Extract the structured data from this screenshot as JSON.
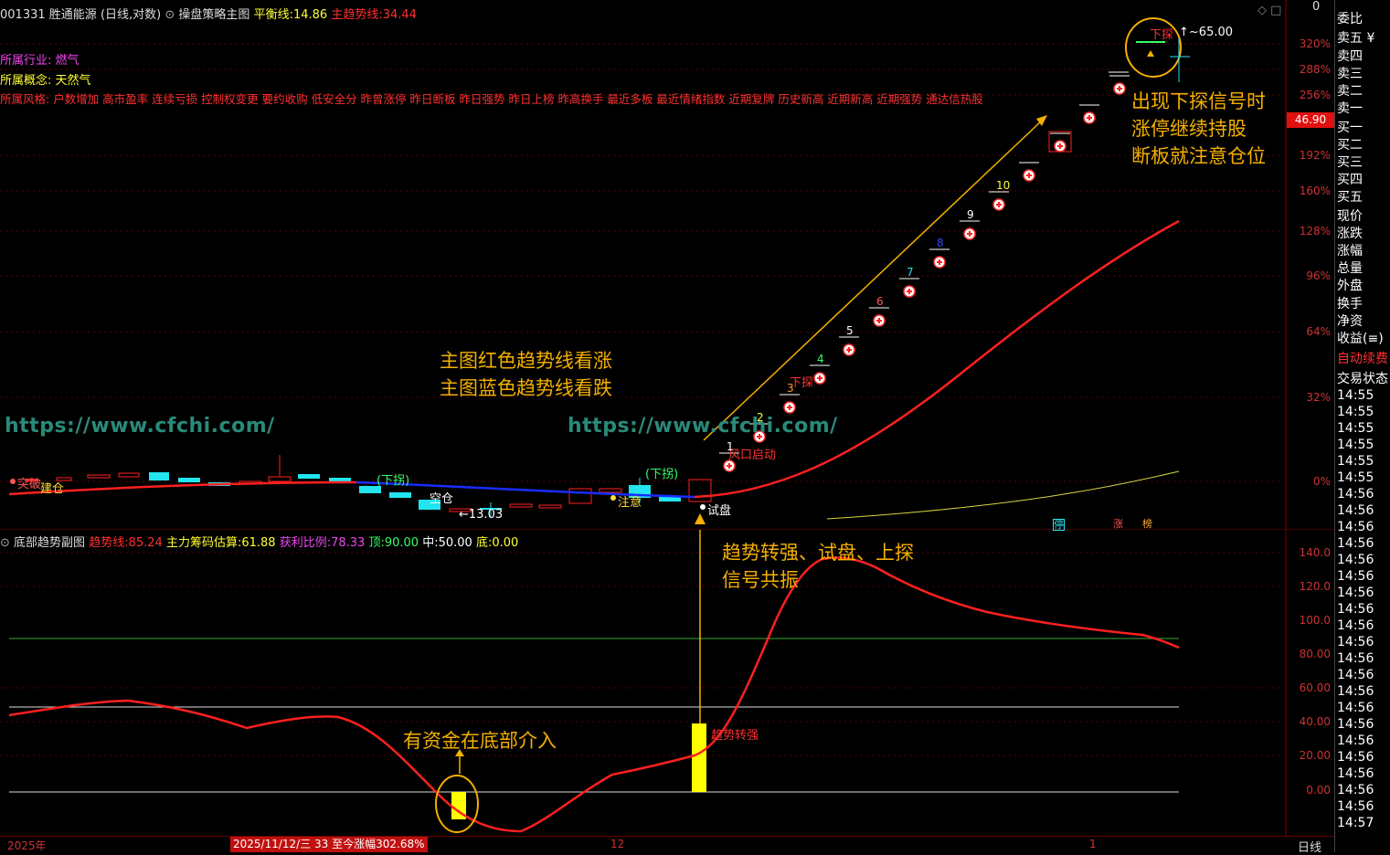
{
  "header": {
    "stock_code": "001331",
    "stock_name": "胜通能源",
    "period": "(日线,对数)",
    "indicator_name": "操盘策略主图",
    "balance_label": "平衡线:",
    "balance_value": "14.86",
    "trend_label": "主趋势线:",
    "trend_value": "34.44"
  },
  "info": {
    "industry_label": "所属行业:",
    "industry_value": "燃气",
    "concept_label": "所属概念:",
    "concept_value": "天然气",
    "style_label": "所属风格:",
    "style_value": "户数增加 高市盈率 连续亏损 控制权变更 要约收购 低安全分 昨曾涨停 昨日断板 昨日强势 昨日上榜 昨高换手 最近多板 最近情绪指数 近期复牌 历史新高 近期新高 近期强势 通达信热股"
  },
  "callouts": {
    "signal_lines": [
      "出现下探信号时",
      "涨停继续持股",
      "断板就注意仓位"
    ],
    "trend_lines": [
      "主图红色趋势线看涨",
      "主图蓝色趋势线看跌"
    ],
    "resonance_lines": [
      "趋势转强、试盘、上探",
      "信号共振"
    ],
    "bottom_fund": "有资金在底部介入"
  },
  "watermark": "https://www.cfchi.com/",
  "main_labels": {
    "breakout": "突破",
    "build": "建仓",
    "xiaguai1": "(下拐)",
    "xiaguai2": "(下拐)",
    "kongcang": "空仓",
    "low_price": "←13.03",
    "attention": "注意",
    "trial": "试盘",
    "wind_start": "风口启动",
    "probe1": "下探",
    "probe2": "下探",
    "high_price": "65.00",
    "stop": "停",
    "zhang": "涨",
    "bang": "榜"
  },
  "counts": [
    "1",
    "2",
    "3",
    "4",
    "5",
    "6",
    "7",
    "8",
    "9",
    "10"
  ],
  "price_axis": {
    "labels": [
      "320%",
      "288%",
      "256%",
      "192%",
      "160%",
      "128%",
      "96%",
      "64%",
      "32%",
      "0%"
    ],
    "current": "46.90"
  },
  "sub_header": {
    "name": "底部趋势副图",
    "trend_label": "趋势线:",
    "trend_value": "85.24",
    "chip_label": "主力筹码估算:",
    "chip_value": "61.88",
    "profit_label": "获利比例:",
    "profit_value": "78.33",
    "top_label": "顶:",
    "top_value": "90.00",
    "mid_label": "中:",
    "mid_value": "50.00",
    "bottom_label": "底:",
    "bottom_value": "0.00",
    "trend_strong": "趋势转强"
  },
  "sub_axis": [
    "140.0",
    "120.0",
    "100.0",
    "80.00",
    "60.00",
    "40.00",
    "20.00",
    "0.00"
  ],
  "bottom_bar": {
    "year": "2025年",
    "range_text": "2025/11/12/三 33 至今涨幅302.68%",
    "month1": "12",
    "month2": "1",
    "period": "日线"
  },
  "right_panel": {
    "items": [
      "委比",
      "卖五 ¥",
      "卖四",
      "卖三",
      "卖二",
      "卖一",
      "买一",
      "买二",
      "买三",
      "买四",
      "买五",
      "现价",
      "涨跌",
      "涨幅",
      "总量",
      "外盘",
      "换手",
      "净资",
      "收益(≡)"
    ],
    "auto_label": "自动续费",
    "trade_state": "交易状态",
    "times": [
      "14:55",
      "14:55",
      "14:55",
      "14:55",
      "14:55",
      "14:55",
      "14:56",
      "14:56",
      "14:56",
      "14:56",
      "14:56",
      "14:56",
      "14:56",
      "14:56",
      "14:56",
      "14:56",
      "14:56",
      "14:56",
      "14:56",
      "14:56",
      "14:56",
      "14:56",
      "14:56",
      "14:56",
      "14:56",
      "14:56",
      "14:57"
    ]
  },
  "colors": {
    "bg": "#000000",
    "red": "#ff2020",
    "blue": "#1a2cff",
    "cyan": "#22e5f0",
    "yellow": "#ffff00",
    "orange": "#f5b000",
    "magenta": "#ff44ff",
    "green": "#33ff66"
  }
}
